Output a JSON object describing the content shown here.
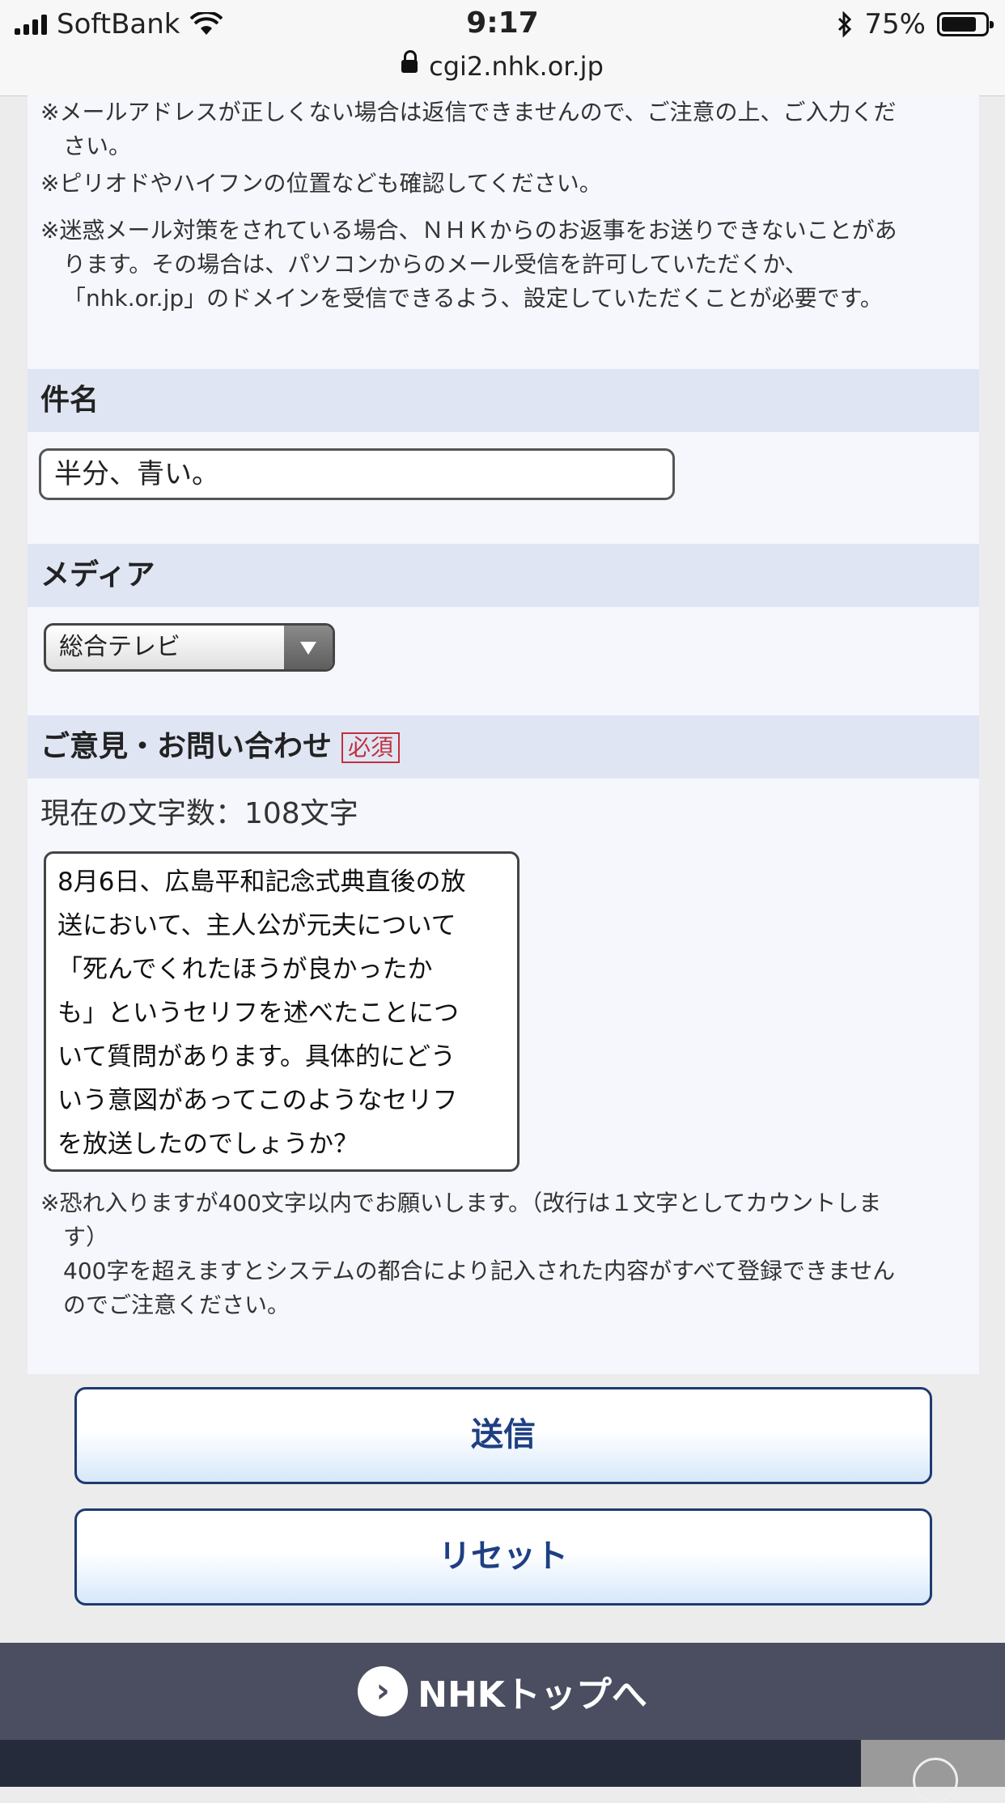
{
  "status_bar": {
    "carrier": "SoftBank",
    "time": "9:17",
    "battery": "75%"
  },
  "url_bar": {
    "url": "cgi2.nhk.or.jp"
  },
  "email_notes": {
    "note1_a": "※メールアドレスが正しくない場合は返信できませんので、ご注意の上、ご入力くだ",
    "note1_b": "さい。",
    "note2": "※ピリオドやハイフンの位置なども確認してください。",
    "note3_a": "※迷惑メール対策をされている場合、ＮＨＫからのお返事をお送りできないことがあ",
    "note3_b": "ります。その場合は、パソコンからのメール受信を許可していただくか、",
    "note3_c": "「nhk.or.jp」のドメインを受信できるよう、設定していただくことが必要です。"
  },
  "subject": {
    "label": "件名",
    "value": "半分、青い。"
  },
  "media": {
    "label": "メディア",
    "selected": "総合テレビ"
  },
  "opinion": {
    "label": "ご意見・お問い合わせ",
    "required": "必須",
    "counter": "現在の文字数：108文字",
    "text": "8月6日、広島平和記念式典直後の放\n送において、主人公が元夫について\n「死んでくれたほうが良かったか\nも」というセリフを述べたことにつ\nいて質問があります。具体的にどう\nいう意図があってこのようなセリフ\nを放送したのでしょうか？",
    "limit_note_a": "※恐れ入りますが400文字以内でお願いします。（改行は１文字としてカウントしま",
    "limit_note_b": "す）",
    "limit_note_c": "400字を超えますとシステムの都合により記入された内容がすべて登録できません",
    "limit_note_d": "のでご注意ください。"
  },
  "buttons": {
    "submit": "送信",
    "reset": "リセット"
  },
  "footer": {
    "link": "NHKトップへ",
    "arrow_glyph": "›"
  }
}
